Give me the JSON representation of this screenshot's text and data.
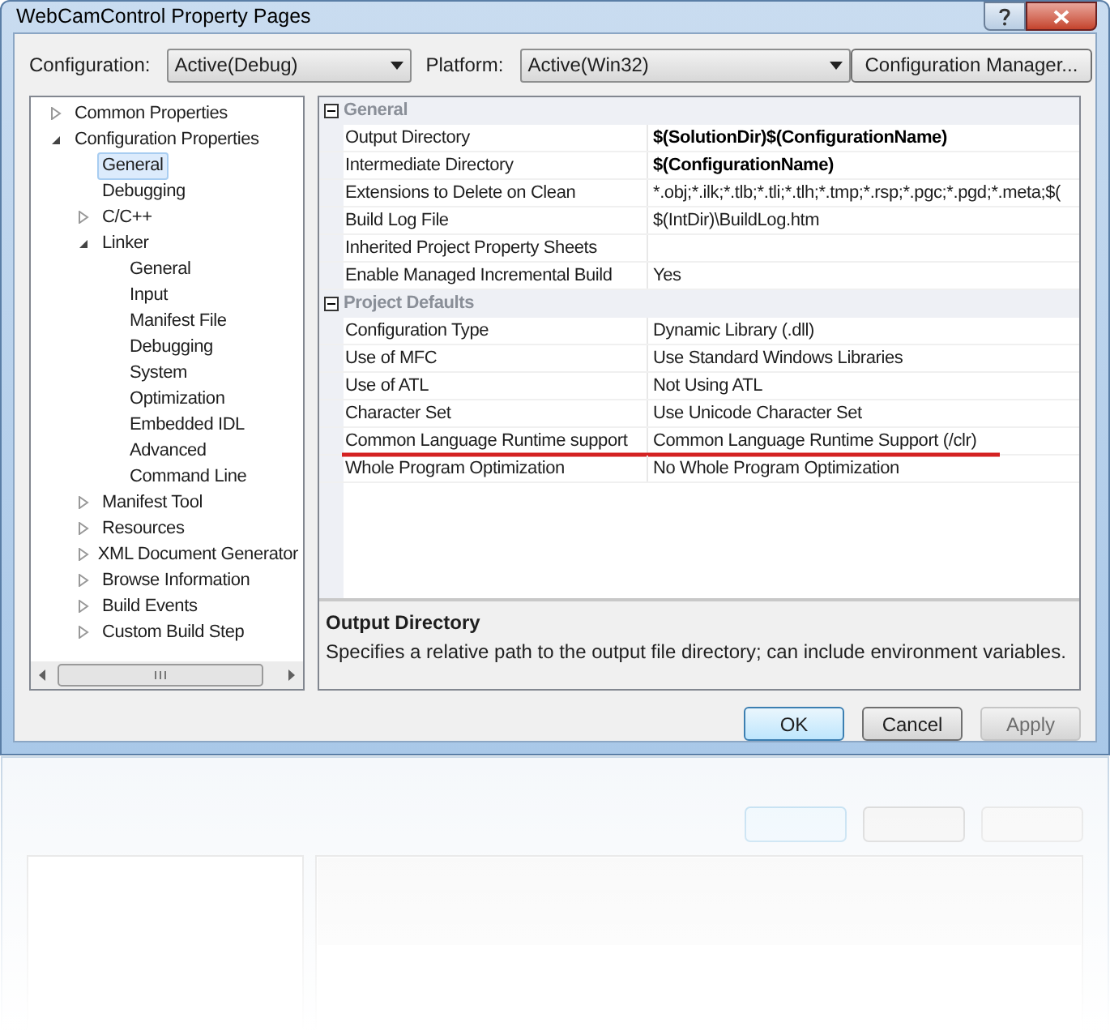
{
  "window": {
    "title": "WebCamControl Property Pages"
  },
  "toolbar": {
    "configuration_label": "Configuration:",
    "configuration_value": "Active(Debug)",
    "platform_label": "Platform:",
    "platform_value": "Active(Win32)",
    "manager_button": "Configuration Manager..."
  },
  "tree": [
    {
      "label": "Common Properties",
      "expanded": false,
      "selected": false
    },
    {
      "label": "Configuration Properties",
      "expanded": true,
      "selected": false,
      "children": [
        {
          "label": "General",
          "selected": true
        },
        {
          "label": "Debugging",
          "selected": false
        },
        {
          "label": "C/C++",
          "expanded": false,
          "selected": false
        },
        {
          "label": "Linker",
          "expanded": true,
          "selected": false,
          "children": [
            {
              "label": "General",
              "selected": false
            },
            {
              "label": "Input",
              "selected": false
            },
            {
              "label": "Manifest File",
              "selected": false
            },
            {
              "label": "Debugging",
              "selected": false
            },
            {
              "label": "System",
              "selected": false
            },
            {
              "label": "Optimization",
              "selected": false
            },
            {
              "label": "Embedded IDL",
              "selected": false
            },
            {
              "label": "Advanced",
              "selected": false
            },
            {
              "label": "Command Line",
              "selected": false
            }
          ]
        },
        {
          "label": "Manifest Tool",
          "expanded": false,
          "selected": false
        },
        {
          "label": "Resources",
          "expanded": false,
          "selected": false
        },
        {
          "label": "XML Document Generator",
          "expanded": false,
          "selected": false
        },
        {
          "label": "Browse Information",
          "expanded": false,
          "selected": false
        },
        {
          "label": "Build Events",
          "expanded": false,
          "selected": false
        },
        {
          "label": "Custom Build Step",
          "expanded": false,
          "selected": false
        }
      ]
    }
  ],
  "property_grid": [
    {
      "category": "General",
      "expanded": true,
      "rows": [
        {
          "name": "Output Directory",
          "value": "$(SolutionDir)$(ConfigurationName)",
          "bold": true,
          "underlined": false
        },
        {
          "name": "Intermediate Directory",
          "value": "$(ConfigurationName)",
          "bold": true,
          "underlined": false
        },
        {
          "name": "Extensions to Delete on Clean",
          "value": "*.obj;*.ilk;*.tlb;*.tli;*.tlh;*.tmp;*.rsp;*.pgc;*.pgd;*.meta;$(",
          "bold": false,
          "underlined": false
        },
        {
          "name": "Build Log File",
          "value": "$(IntDir)\\BuildLog.htm",
          "bold": false,
          "underlined": false
        },
        {
          "name": "Inherited Project Property Sheets",
          "underlined": false
        },
        {
          "name": "Enable Managed Incremental Build",
          "value": "Yes",
          "bold": false,
          "underlined": false
        }
      ]
    },
    {
      "category": "Project Defaults",
      "expanded": true,
      "rows": [
        {
          "name": "Configuration Type",
          "value": "Dynamic Library (.dll)",
          "bold": false,
          "underlined": false
        },
        {
          "name": "Use of MFC",
          "value": "Use Standard Windows Libraries",
          "bold": false,
          "underlined": false
        },
        {
          "name": "Use of ATL",
          "value": "Not Using ATL",
          "bold": false,
          "underlined": false
        },
        {
          "name": "Character Set",
          "value": "Use Unicode Character Set",
          "bold": false,
          "underlined": false
        },
        {
          "name": "Common Language Runtime support",
          "value": "Common Language Runtime Support (/clr)",
          "bold": false,
          "underlined": true
        },
        {
          "name": "Whole Program Optimization",
          "value": "No Whole Program Optimization",
          "bold": false,
          "underlined": false
        }
      ]
    }
  ],
  "description": {
    "title": "Output Directory",
    "text": "Specifies a relative path to the output file directory; can include environment variables."
  },
  "buttons": [
    {
      "label": "OK",
      "default": true,
      "disabled": false
    },
    {
      "label": "Cancel",
      "default": false,
      "disabled": false
    },
    {
      "label": "Apply",
      "default": false,
      "disabled": true
    }
  ]
}
